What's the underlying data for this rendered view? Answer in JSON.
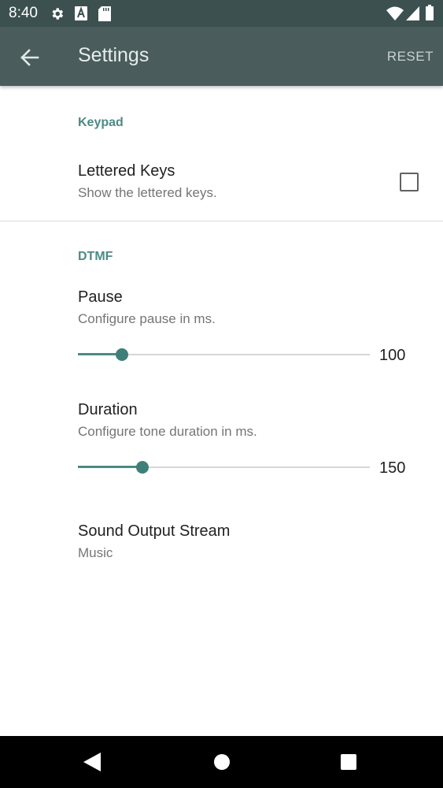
{
  "status_bar": {
    "time": "8:40",
    "icons": [
      "gear-icon",
      "a-notification-icon",
      "sd-card-icon",
      "wifi-icon",
      "signal-icon",
      "battery-icon"
    ]
  },
  "app_bar": {
    "back_icon": "arrow-left-icon",
    "title": "Settings",
    "reset_label": "RESET"
  },
  "keypad": {
    "header": "Keypad",
    "lettered_keys": {
      "title": "Lettered Keys",
      "summary": "Show the lettered keys.",
      "checked": false
    }
  },
  "dtmf": {
    "header": "DTMF",
    "pause": {
      "title": "Pause",
      "summary": "Configure pause in ms.",
      "value": "100",
      "fraction": 0.15
    },
    "duration": {
      "title": "Duration",
      "summary": "Configure tone duration in ms.",
      "value": "150",
      "fraction": 0.22
    },
    "sound_output": {
      "title": "Sound Output Stream",
      "summary": "Music"
    }
  },
  "nav_bar": {
    "icons": [
      "back-triangle-icon",
      "home-circle-icon",
      "recents-square-icon"
    ]
  },
  "colors": {
    "status_bar": "#3c5050",
    "app_bar": "#4a5c5c",
    "accent": "#4d8a85"
  }
}
